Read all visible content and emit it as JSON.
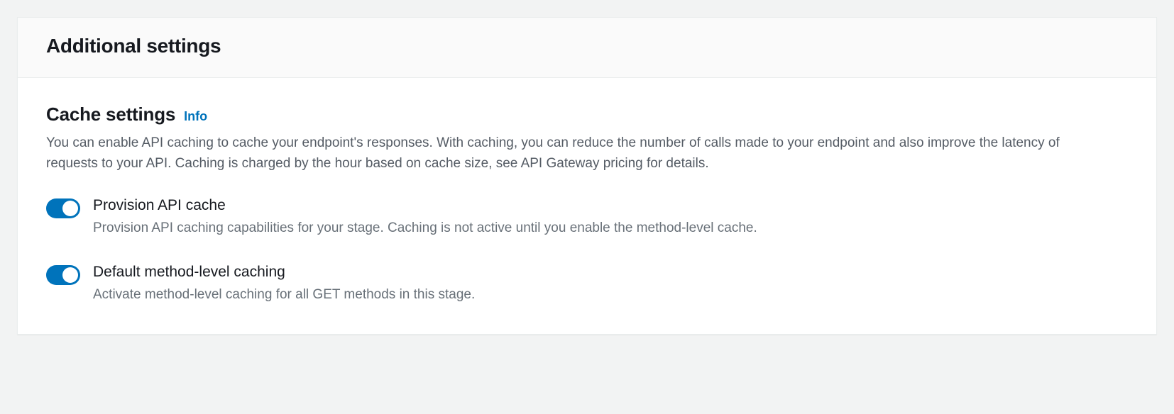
{
  "panel": {
    "title": "Additional settings"
  },
  "cache": {
    "title": "Cache settings",
    "info_label": "Info",
    "description": "You can enable API caching to cache your endpoint's responses. With caching, you can reduce the number of calls made to your endpoint and also improve the latency of requests to your API. Caching is charged by the hour based on cache size, see API Gateway pricing for details.",
    "toggles": [
      {
        "label": "Provision API cache",
        "help": "Provision API caching capabilities for your stage. Caching is not active until you enable the method-level cache.",
        "on": true
      },
      {
        "label": "Default method-level caching",
        "help": "Activate method-level caching for all GET methods in this stage.",
        "on": true
      }
    ]
  }
}
